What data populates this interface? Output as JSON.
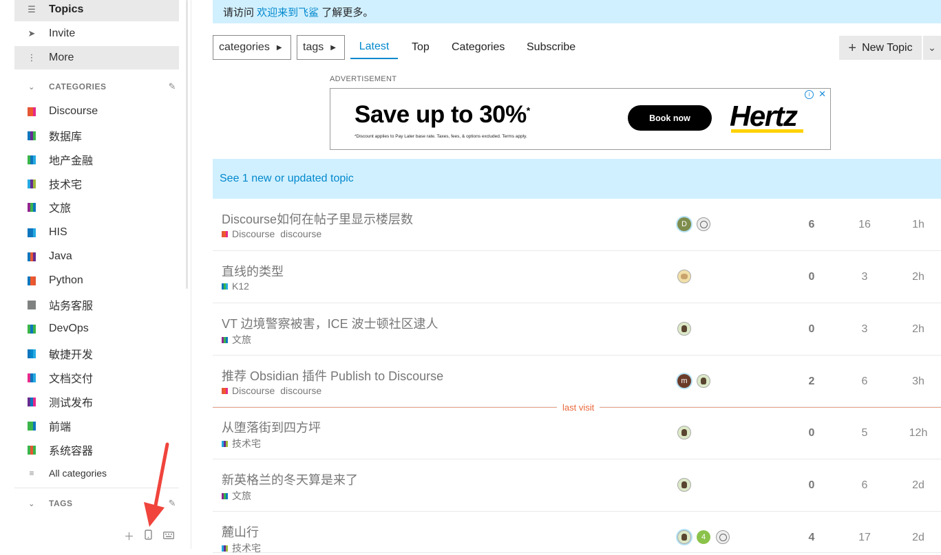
{
  "sidebar": {
    "primary": [
      {
        "label": "Topics",
        "icon": "layers-icon",
        "active": true
      },
      {
        "label": "Invite",
        "icon": "paper-plane-icon"
      },
      {
        "label": "More",
        "icon": "ellipsis-vertical-icon",
        "active": true
      }
    ],
    "categories_title": "CATEGORIES",
    "categories": [
      {
        "label": "Discourse",
        "colors": [
          "#e45735",
          "#f1592a",
          "#e52a8b"
        ]
      },
      {
        "label": "数据库",
        "colors": [
          "#0e76bd",
          "#652d90",
          "#3ab54a"
        ]
      },
      {
        "label": "地产金融",
        "colors": [
          "#3ab54a",
          "#0e76bd",
          "#25aae2"
        ]
      },
      {
        "label": "技术宅",
        "colors": [
          "#25aae2",
          "#652d90",
          "#9eb83b"
        ]
      },
      {
        "label": "文旅",
        "colors": [
          "#92278f",
          "#3ab54a",
          "#0e76bd"
        ]
      },
      {
        "label": "HIS",
        "colors": [
          "#0e76bd",
          "#0e76bd",
          "#25aae2"
        ]
      },
      {
        "label": "Java",
        "colors": [
          "#0e76bd",
          "#e45735",
          "#652d90"
        ]
      },
      {
        "label": "Python",
        "colors": [
          "#0e76bd",
          "#f1592a",
          "#e45735"
        ]
      },
      {
        "label": "站务客服",
        "colors": [
          "#808281",
          "#808281",
          "#808281"
        ]
      },
      {
        "label": "DevOps",
        "colors": [
          "#3ab54a",
          "#0e76bd",
          "#3ab54a"
        ]
      },
      {
        "label": "敏捷开发",
        "colors": [
          "#0e76bd",
          "#0088cc",
          "#25aae2"
        ]
      },
      {
        "label": "文档交付",
        "colors": [
          "#e52a8b",
          "#0e76bd",
          "#25aae2"
        ]
      },
      {
        "label": "测试发布",
        "colors": [
          "#652d90",
          "#0e76bd",
          "#e52a8b"
        ]
      },
      {
        "label": "前端",
        "colors": [
          "#3ab54a",
          "#3ab54a",
          "#0e76bd"
        ]
      },
      {
        "label": "系统容器",
        "colors": [
          "#3ab54a",
          "#e45735",
          "#3ab54a"
        ]
      }
    ],
    "all_categories": "All categories",
    "tags_title": "TAGS"
  },
  "banner": {
    "prefix": "请访问 ",
    "link": "欢迎来到飞鲨",
    "suffix": " 了解更多。"
  },
  "filters": {
    "categories": "categories",
    "tags": "tags"
  },
  "nav": [
    "Latest",
    "Top",
    "Categories",
    "Subscribe"
  ],
  "new_topic": "New Topic",
  "ad": {
    "label": "ADVERTISEMENT",
    "headline": "Save up to 30%",
    "headline_mark": "*",
    "fine_print": "*Discount applies to Pay Later base rate. Taxes, fees, & options excluded. Terms apply.",
    "cta": "Book now",
    "brand": "Hertz"
  },
  "new_topics_notice": "See 1 new or updated topic",
  "last_visit": "last visit",
  "topics": [
    {
      "title": "Discourse如何在帖子里显示楼层数",
      "category": "Discourse",
      "cat_colors": [
        "#e45735",
        "#f1592a",
        "#e52a8b"
      ],
      "tag": "discourse",
      "posters": [
        {
          "kind": "letter",
          "letter": "D",
          "color": "#7e8c4c"
        },
        {
          "kind": "bird"
        }
      ],
      "replies": "6",
      "views": "16",
      "activity": "1h"
    },
    {
      "title": "直线的类型",
      "category": "K12",
      "cat_colors": [
        "#0e76bd",
        "#3ab54a",
        "#25aae2"
      ],
      "tag": "",
      "posters": [
        {
          "kind": "beige"
        }
      ],
      "replies": "0",
      "views": "3",
      "activity": "2h"
    },
    {
      "title": "VT 边境警察被害，ICE 波士顿社区逮人",
      "category": "文旅",
      "cat_colors": [
        "#92278f",
        "#3ab54a",
        "#0e76bd"
      ],
      "tag": "",
      "posters": [
        {
          "kind": "face"
        }
      ],
      "replies": "0",
      "views": "3",
      "activity": "2h"
    },
    {
      "title": "推荐 Obsidian 插件 Publish to Discourse",
      "category": "Discourse",
      "cat_colors": [
        "#e45735",
        "#f1592a",
        "#e52a8b"
      ],
      "tag": "discourse",
      "posters": [
        {
          "kind": "letter",
          "letter": "m",
          "color": "#6b3b2a"
        },
        {
          "kind": "face"
        }
      ],
      "replies": "2",
      "views": "6",
      "activity": "3h"
    },
    {
      "title": "从堕落街到四方坪",
      "category": "技术宅",
      "cat_colors": [
        "#25aae2",
        "#652d90",
        "#9eb83b"
      ],
      "tag": "",
      "posters": [
        {
          "kind": "face"
        }
      ],
      "replies": "0",
      "views": "5",
      "activity": "12h"
    },
    {
      "title": "新英格兰的冬天算是来了",
      "category": "文旅",
      "cat_colors": [
        "#92278f",
        "#3ab54a",
        "#0e76bd"
      ],
      "tag": "",
      "posters": [
        {
          "kind": "face"
        }
      ],
      "replies": "0",
      "views": "6",
      "activity": "2d"
    },
    {
      "title": "麓山行",
      "category": "技术宅",
      "cat_colors": [
        "#25aae2",
        "#652d90",
        "#9eb83b"
      ],
      "tag": "",
      "posters": [
        {
          "kind": "face",
          "ring": true
        },
        {
          "kind": "letter",
          "letter": "4",
          "color": "#8bc34a"
        },
        {
          "kind": "bird"
        }
      ],
      "replies": "4",
      "views": "17",
      "activity": "2d"
    }
  ]
}
